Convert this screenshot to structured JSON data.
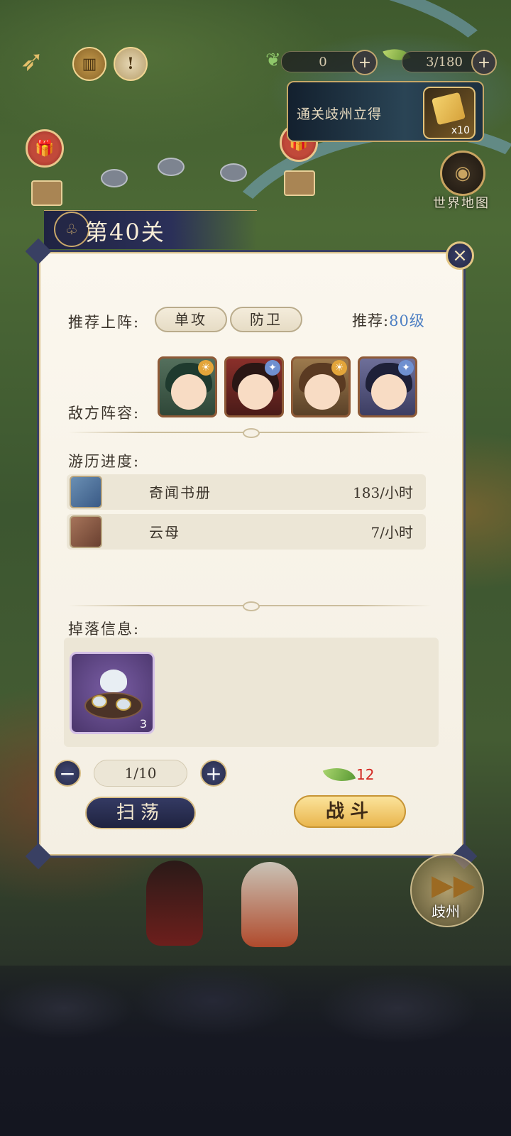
{
  "hud": {
    "resource_a_value": "0",
    "resource_b_value": "3/180",
    "resource_plus_a": "+",
    "resource_plus_b": "+",
    "info_icon": "!",
    "back_icon": "back-arrow-icon"
  },
  "reward_banner": {
    "text": "通关歧州立得",
    "count": "x10"
  },
  "world_map": {
    "label": "世界地图"
  },
  "level": {
    "title": "第40关"
  },
  "panel": {
    "close_glyph": "×",
    "recommend_label": "推荐上阵:",
    "tags": [
      "单攻",
      "防卫"
    ],
    "recommend_level_prefix": "推荐:",
    "recommend_level_value": "80级",
    "enemy_label": "敌方阵容:",
    "progress_label": "游历进度:",
    "progress": [
      {
        "name": "奇闻书册",
        "rate": "183/小时"
      },
      {
        "name": "云母",
        "rate": "7/小时"
      }
    ],
    "drop_label": "掉落信息:",
    "drop_items": [
      {
        "qty": "3",
        "icon": "tea-set-icon"
      }
    ],
    "stepper": {
      "minus": "−",
      "value": "1/10",
      "plus": "+"
    },
    "cost": "12",
    "sweep_label": "扫荡",
    "fight_label": "战斗"
  },
  "next_stage": {
    "label": "歧州"
  },
  "colors": {
    "panel_border": "#394063",
    "accent_gold": "#d9bf87",
    "level_blue": "#4d7fc3",
    "cost_red": "#d3261f"
  }
}
